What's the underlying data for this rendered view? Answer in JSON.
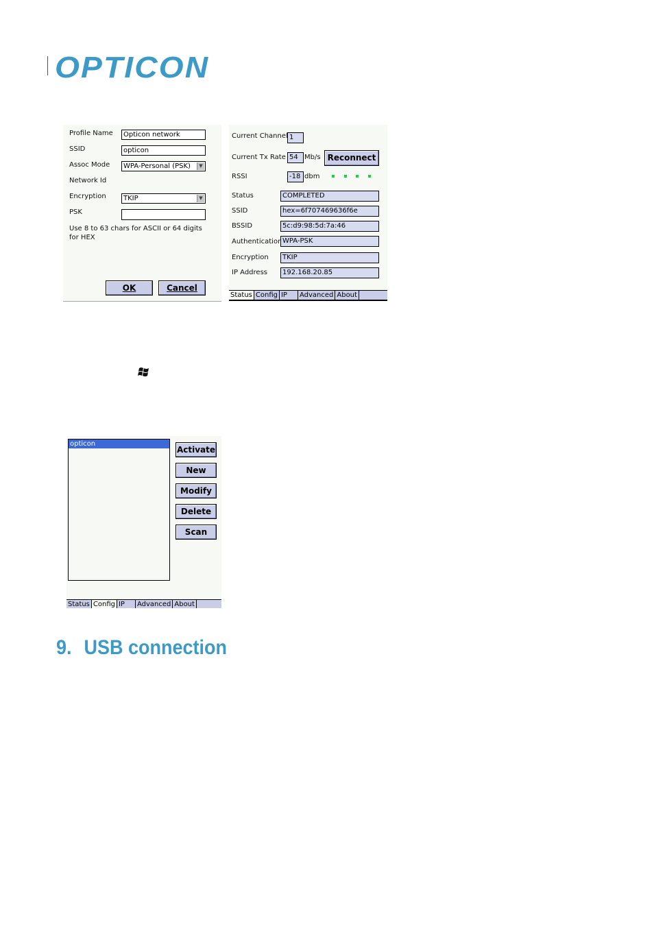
{
  "header": {
    "logo_text": "OPTICON"
  },
  "profile_form": {
    "profile_name_label": "Profile Name",
    "profile_name_value": "Opticon network",
    "ssid_label": "SSID",
    "ssid_value": "opticon",
    "assoc_mode_label": "Assoc Mode",
    "assoc_mode_value": "WPA-Personal (PSK)",
    "network_id_label": "Network Id",
    "encryption_label": "Encryption",
    "encryption_value": "TKIP",
    "psk_label": "PSK",
    "psk_value": "",
    "hint_text": "Use 8 to 63 chars for ASCII or 64 digits for HEX",
    "ok_label": "OK",
    "cancel_label": "Cancel"
  },
  "status_panel": {
    "channel_label": "Current Channel",
    "channel_value": "1",
    "tx_rate_label": "Current Tx Rate",
    "tx_rate_value": "54",
    "tx_rate_unit": "Mb/s",
    "reconnect_label": "Reconnect",
    "rssi_label": "RSSI",
    "rssi_value": "-18",
    "rssi_unit": "dbm",
    "signal_bars": 4,
    "signal_color": "#17d63c",
    "status_label": "Status",
    "status_value": "COMPLETED",
    "ssid_label": "SSID",
    "ssid_value": "hex=6f707469636f6e",
    "bssid_label": "BSSID",
    "bssid_value": "5c:d9:98:5d:7a:46",
    "auth_label": "Authentication",
    "auth_value": "WPA-PSK",
    "enc_label": "Encryption",
    "enc_value": "TKIP",
    "ip_label": "IP Address",
    "ip_value": "192.168.20.85",
    "tabs": [
      "Status",
      "Config",
      "IP",
      "Advanced",
      "About"
    ],
    "active_tab": "Status"
  },
  "windows_icon": "windows-flag-icon",
  "config_panel": {
    "profiles": [
      "opticon"
    ],
    "selected_profile": "opticon",
    "buttons": [
      "Activate",
      "New",
      "Modify",
      "Delete",
      "Scan"
    ],
    "tabs": [
      "Status",
      "Config",
      "IP",
      "Advanced",
      "About"
    ],
    "active_tab": "Config"
  },
  "section": {
    "number": "9.",
    "title": "USB connection"
  },
  "colors": {
    "brand": "#3d9ac7",
    "button": "#c9cde8",
    "readonly_field": "#d7dbf0",
    "selection": "#3d69d6"
  }
}
